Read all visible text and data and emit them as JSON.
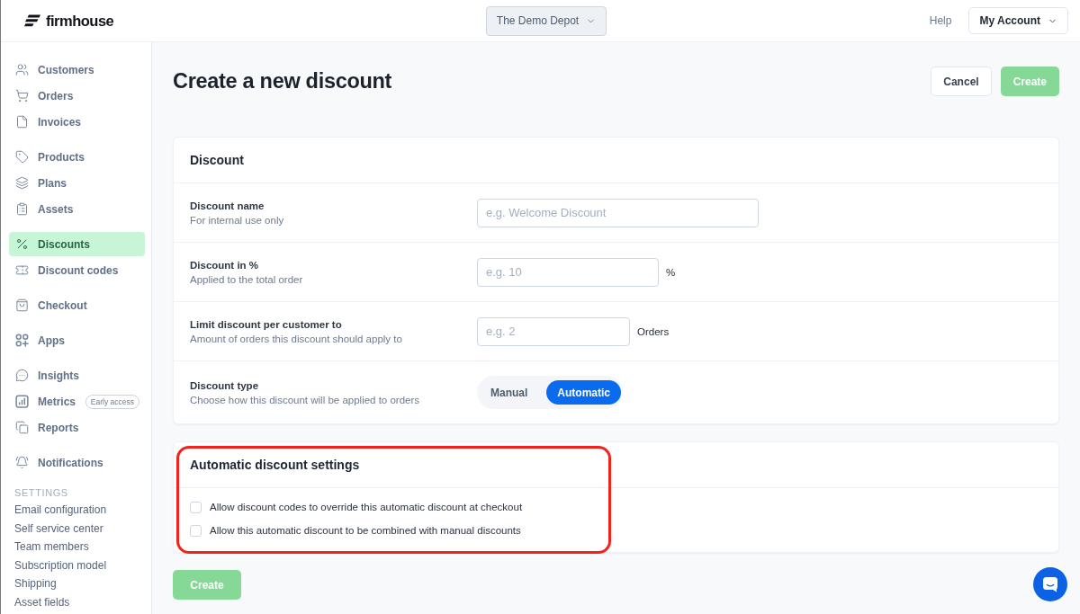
{
  "topbar": {
    "logo": "firmhouse",
    "project": "The Demo Depot",
    "help": "Help",
    "account": "My Account"
  },
  "sidebar": {
    "groups": [
      {
        "items": [
          {
            "label": "Customers",
            "selected": false
          },
          {
            "label": "Orders",
            "selected": false
          },
          {
            "label": "Invoices",
            "selected": false
          }
        ]
      },
      {
        "items": [
          {
            "label": "Products",
            "selected": false
          },
          {
            "label": "Plans",
            "selected": false
          },
          {
            "label": "Assets",
            "selected": false
          }
        ]
      },
      {
        "items": [
          {
            "label": "Discounts",
            "selected": true
          },
          {
            "label": "Discount codes",
            "selected": false
          }
        ]
      },
      {
        "items": [
          {
            "label": "Checkout",
            "selected": false
          }
        ]
      },
      {
        "items": [
          {
            "label": "Apps",
            "selected": false
          }
        ]
      },
      {
        "items": [
          {
            "label": "Insights",
            "selected": false
          },
          {
            "label": "Metrics",
            "selected": false,
            "badge": "Early access"
          },
          {
            "label": "Reports",
            "selected": false
          }
        ]
      },
      {
        "items": [
          {
            "label": "Notifications",
            "selected": false
          }
        ]
      }
    ],
    "settings": {
      "heading": "SETTINGS",
      "items": [
        "Email configuration",
        "Self service center",
        "Team members",
        "Subscription model",
        "Shipping",
        "Asset fields"
      ]
    }
  },
  "page": {
    "title": "Create a new discount",
    "actions": [
      {
        "label": "Cancel",
        "kind": "secondary",
        "disabled": false
      },
      {
        "label": "Create",
        "kind": "primary",
        "disabled": true
      }
    ]
  },
  "discount_card": {
    "title": "Discount",
    "fields": [
      {
        "kind": "text",
        "label": "Discount name",
        "description": "For internal use only",
        "placeholder": "e.g. Welcome Discount"
      },
      {
        "kind": "text",
        "label": "Discount in %",
        "description": "Applied to the total order",
        "placeholder": "e.g. 10",
        "unit": "%"
      },
      {
        "kind": "text",
        "label": "Limit discount per customer to",
        "description": "Amount of orders this discount should apply to",
        "placeholder": "e.g. 2",
        "unit": "Orders"
      },
      {
        "kind": "choice",
        "label": "Discount type",
        "description": "Choose how this discount will be applied to orders",
        "options": [
          {
            "label": "Manual",
            "selected": false
          },
          {
            "label": "Automatic",
            "selected": true
          }
        ]
      }
    ]
  },
  "automatic_card": {
    "title": "Automatic discount settings",
    "highlighted": true,
    "options": [
      {
        "label": "Allow discount codes to override this automatic discount at checkout",
        "checked": false
      },
      {
        "label": "Allow this automatic discount to be combined with manual discounts",
        "checked": false
      }
    ]
  },
  "footer": {
    "button": {
      "label": "Create",
      "disabled": true
    }
  }
}
